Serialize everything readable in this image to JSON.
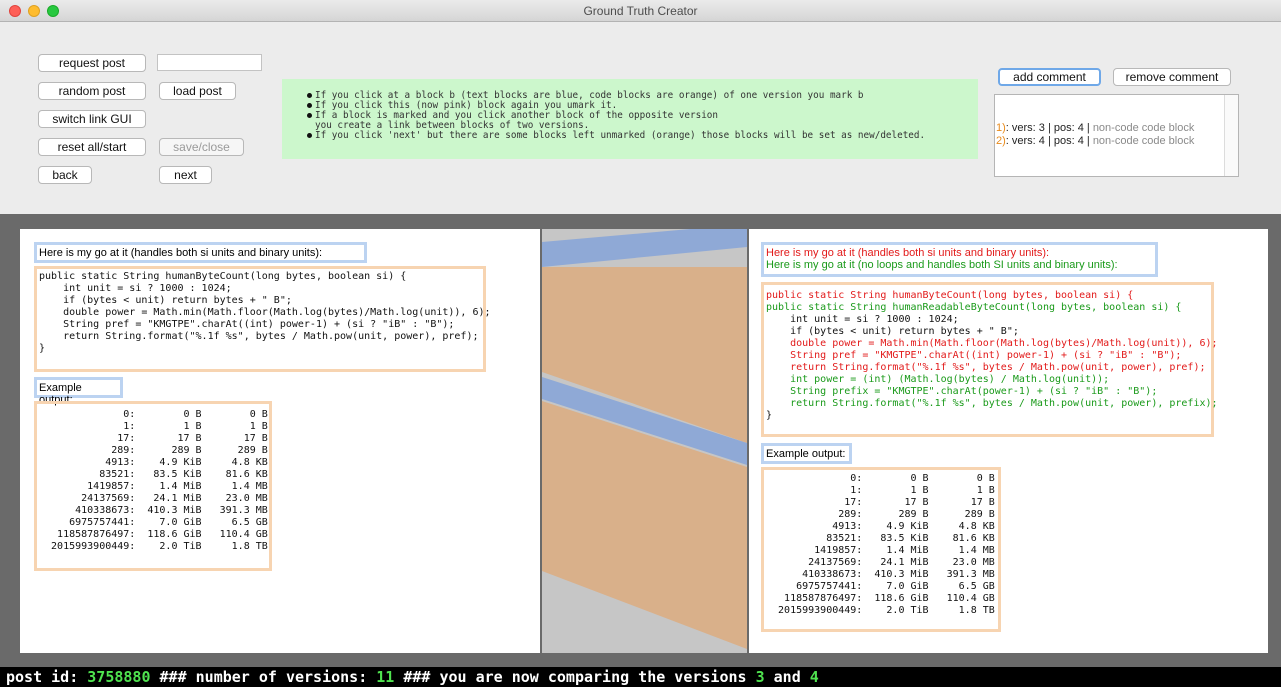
{
  "window": {
    "title": "Ground Truth Creator"
  },
  "toolbar": {
    "request_post": "request post",
    "random_post": "random post",
    "load_post": "load post",
    "switch_link_gui": "switch link GUI",
    "reset_all": "reset all/start",
    "save_close": "save/close",
    "back": "back",
    "next": "next",
    "post_input_value": "",
    "add_comment": "add comment",
    "remove_comment": "remove comment"
  },
  "instructions": [
    "If you click at a block b (text blocks are blue, code blocks are orange) of one version you mark b",
    "If you click this (now pink) block again you umark it.",
    "If a block is marked and you click another block of the opposite version",
    "you create a link between blocks of two versions.",
    "If you click 'next' but there are some blocks left unmarked (orange) those blocks will be set as new/deleted."
  ],
  "comments": [
    {
      "num": "1)",
      "text": ": vers: 3 | pos: 4 | ",
      "type": "non-code code block"
    },
    {
      "num": "2)",
      "text": ": vers: 4 | pos: 4 | ",
      "type": "non-code code block"
    }
  ],
  "colors": {
    "text_block_border": "#bcd3f1",
    "code_block_border": "#f7d4b1",
    "removed": "#e21a1a",
    "added": "#1a9a1a",
    "link_blue": "#8fa9d6",
    "link_orange": "#d9b08a",
    "info_bg": "#ccf7cc"
  },
  "left": {
    "text1": "Here is my go at it (handles both si units and binary units):",
    "code1": "public static String humanByteCount(long bytes, boolean si) {\n    int unit = si ? 1000 : 1024;\n    if (bytes < unit) return bytes + \" B\";\n    double power = Math.min(Math.floor(Math.log(bytes)/Math.log(unit)), 6);\n    String pref = \"KMGTPE\".charAt((int) power-1) + (si ? \"iB\" : \"B\");\n    return String.format(\"%.1f %s\", bytes / Math.pow(unit, power), pref);\n}",
    "text2": "Example output:",
    "code2": "              0:        0 B        0 B\n              1:        1 B        1 B\n             17:       17 B       17 B\n            289:      289 B      289 B\n           4913:    4.9 KiB     4.8 KB\n          83521:   83.5 KiB    81.6 KB\n        1419857:    1.4 MiB     1.4 MB\n       24137569:   24.1 MiB    23.0 MB\n      410338673:  410.3 MiB   391.3 MB\n     6975757441:    7.0 GiB     6.5 GB\n   118587876497:  118.6 GiB   110.4 GB\n  2015993900449:    2.0 TiB     1.8 TB"
  },
  "right": {
    "text1_removed": "Here is my go at it (handles both si units and binary units):",
    "text1_added": "Here is my go at it (no loops and handles both SI units and binary units):",
    "code1": [
      {
        "t": "public static String humanByteCount(long bytes, boolean si) {",
        "c": "red"
      },
      {
        "t": "public static String humanReadableByteCount(long bytes, boolean si) {",
        "c": "green"
      },
      {
        "t": "    int unit = si ? 1000 : 1024;",
        "c": ""
      },
      {
        "t": "    if (bytes < unit) return bytes + \" B\";",
        "c": ""
      },
      {
        "t": "    double power = Math.min(Math.floor(Math.log(bytes)/Math.log(unit)), 6);",
        "c": "red"
      },
      {
        "t": "    String pref = \"KMGTPE\".charAt((int) power-1) + (si ? \"iB\" : \"B\");",
        "c": "red"
      },
      {
        "t": "    return String.format(\"%.1f %s\", bytes / Math.pow(unit, power), pref);",
        "c": "red"
      },
      {
        "t": "    int power = (int) (Math.log(bytes) / Math.log(unit));",
        "c": "green"
      },
      {
        "t": "    String prefix = \"KMGTPE\".charAt(power-1) + (si ? \"iB\" : \"B\");",
        "c": "green"
      },
      {
        "t": "    return String.format(\"%.1f %s\", bytes / Math.pow(unit, power), prefix);",
        "c": "green"
      },
      {
        "t": "}",
        "c": ""
      }
    ],
    "text2": "Example output:",
    "code2": "              0:        0 B        0 B\n              1:        1 B        1 B\n             17:       17 B       17 B\n            289:      289 B      289 B\n           4913:    4.9 KiB     4.8 KB\n          83521:   83.5 KiB    81.6 KB\n        1419857:    1.4 MiB     1.4 MB\n       24137569:   24.1 MiB    23.0 MB\n      410338673:  410.3 MiB   391.3 MB\n     6975757441:    7.0 GiB     6.5 GB\n   118587876497:  118.6 GiB   110.4 GB\n  2015993900449:    2.0 TiB     1.8 TB"
  },
  "status": {
    "label_post": "post id: ",
    "post_id": "3758880",
    "sep1": " ### number of versions: ",
    "num_versions": "11",
    "sep2": " ### you are now comparing the versions ",
    "v1": "3",
    "and": " and ",
    "v2": "4"
  }
}
